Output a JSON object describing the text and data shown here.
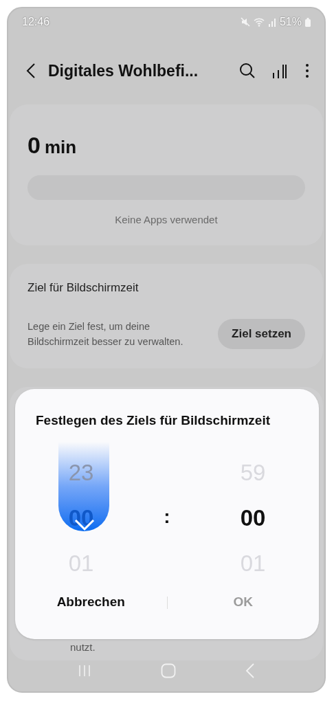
{
  "status_bar": {
    "time": "12:46",
    "battery": "51%"
  },
  "header": {
    "title": "Digitales Wohlbefi..."
  },
  "usage_card": {
    "value": "0",
    "unit": "min",
    "empty_text": "Keine Apps verwendet"
  },
  "goal_card": {
    "title": "Ziel für Bildschirmzeit",
    "description": "Lege ein Ziel fest, um deine Bildschirmzeit besser zu verwalten.",
    "button": "Ziel setzen"
  },
  "third_card": {
    "text": "nutzt."
  },
  "dialog": {
    "title": "Festlegen des Ziels für Bildschirmzeit",
    "hours": {
      "above": "23",
      "selected": "00",
      "below": "01"
    },
    "separator": ":",
    "minutes": {
      "above": "59",
      "selected": "00",
      "below": "01"
    },
    "buttons": [
      {
        "label": "Abbrechen",
        "disabled": false
      },
      {
        "label": "OK",
        "disabled": true
      }
    ]
  }
}
